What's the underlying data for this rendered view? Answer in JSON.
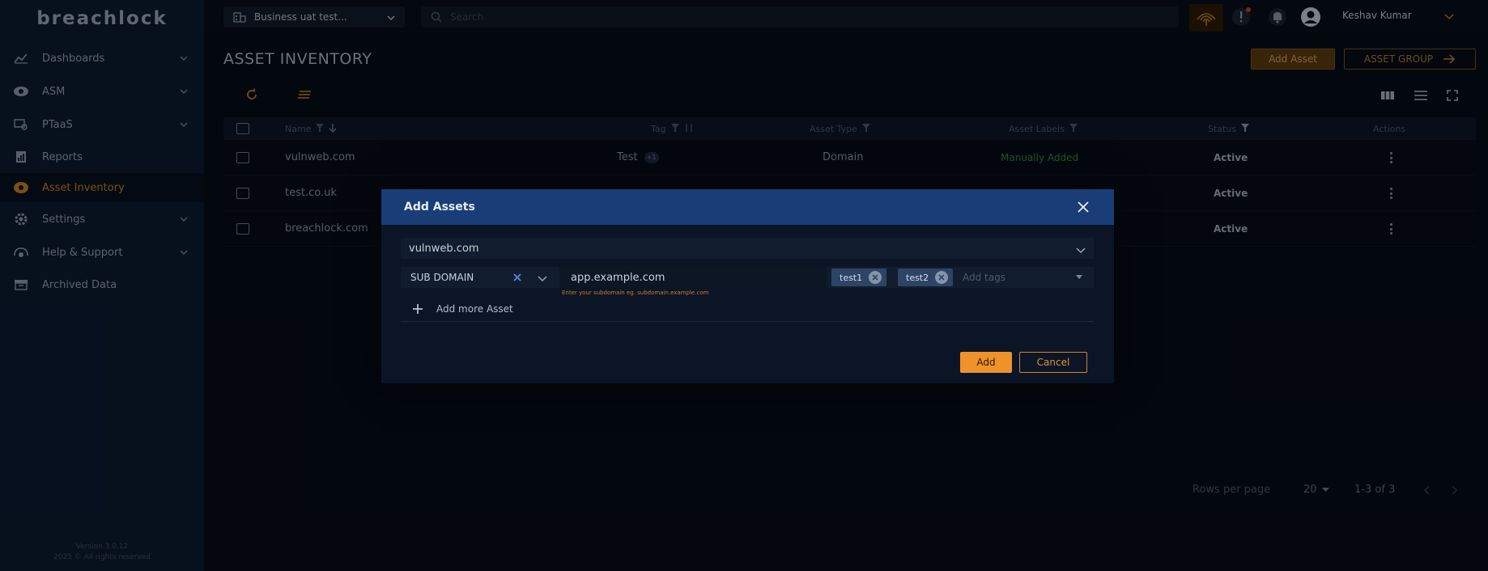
{
  "sidebar": {
    "logo": "breachlock",
    "items": [
      {
        "label": "Dashboards",
        "icon": "chart-icon",
        "has_chevron": true
      },
      {
        "label": "ASM",
        "icon": "eye-icon",
        "has_chevron": true
      },
      {
        "label": "PTaaS",
        "icon": "ptaas-icon",
        "has_chevron": true
      },
      {
        "label": "Reports",
        "icon": "report-icon",
        "has_chevron": false
      },
      {
        "label": "Asset Inventory",
        "icon": "asset-icon",
        "has_chevron": false,
        "active": true
      },
      {
        "label": "Settings",
        "icon": "gear-icon",
        "has_chevron": true
      },
      {
        "label": "Help & Support",
        "icon": "help-icon",
        "has_chevron": true
      },
      {
        "label": "Archived Data",
        "icon": "archive-icon",
        "has_chevron": false
      }
    ],
    "version": "Version 3.0.12",
    "copyright": "2025 © All rights reserved"
  },
  "topbar": {
    "business": "Business uat test...",
    "search_placeholder": "Search",
    "user_name": "Keshav Kumar"
  },
  "page": {
    "title": "ASSET INVENTORY",
    "add_asset_label": "Add Asset",
    "asset_group_label": "ASSET GROUP"
  },
  "table": {
    "columns": [
      "Name",
      "Tag",
      "Asset Type",
      "Asset Labels",
      "Status",
      "Actions"
    ],
    "rows": [
      {
        "name": "vulnweb.com",
        "tag": "Test",
        "tag_extra": "+1",
        "type": "Domain",
        "label": "Manually Added",
        "status": "Active"
      },
      {
        "name": "test.co.uk",
        "tag": "",
        "tag_extra": "",
        "type": "",
        "label": "",
        "status": "Active"
      },
      {
        "name": "breachlock.com",
        "tag": "",
        "tag_extra": "",
        "type": "",
        "label": "",
        "status": "Active"
      }
    ]
  },
  "pagination": {
    "rows_per_page_label": "Rows per page",
    "rows_per_page": "20",
    "range": "1-3 of 3"
  },
  "modal": {
    "title": "Add Assets",
    "domain": "vulnweb.com",
    "asset_type": "SUB DOMAIN",
    "subdomain_value": "app.example.com",
    "helper": "Enter your subdomain eg. subdomain.example.com",
    "tags": [
      "test1",
      "test2"
    ],
    "tags_placeholder": "Add tags",
    "add_more_label": "Add more Asset",
    "add_label": "Add",
    "cancel_label": "Cancel"
  },
  "colors": {
    "accent": "#f0922a",
    "modal_header": "#1a3d77",
    "label_green": "#2c8a3e",
    "sidebar_bg": "#0c1a30"
  }
}
